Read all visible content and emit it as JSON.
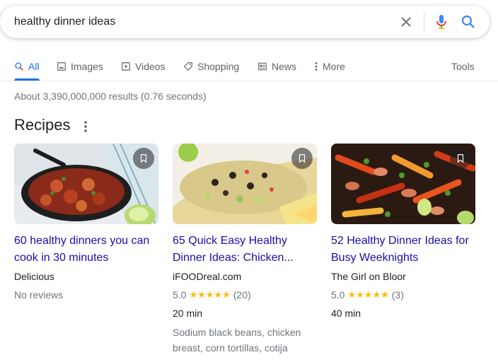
{
  "search": {
    "query": "healthy dinner ideas",
    "clear_icon": "close-icon",
    "mic_icon": "mic-icon",
    "search_icon": "search-icon"
  },
  "tabs": [
    {
      "label": "All",
      "icon": "search-icon",
      "active": true
    },
    {
      "label": "Images",
      "icon": "image-icon"
    },
    {
      "label": "Videos",
      "icon": "video-icon"
    },
    {
      "label": "Shopping",
      "icon": "tag-icon"
    },
    {
      "label": "News",
      "icon": "news-icon"
    },
    {
      "label": "More",
      "icon": "kebab-icon"
    },
    {
      "label": "Tools"
    }
  ],
  "results_stats": "About 3,390,000,000 results (0.76 seconds)",
  "recipes": {
    "title": "Recipes",
    "cards": [
      {
        "title_line1": "60 healthy dinners you can",
        "title_line2": "cook in 30 minutes",
        "source": "Delicious",
        "reviews": "No reviews"
      },
      {
        "title_line1": "65 Quick Easy Healthy",
        "title_line2": "Dinner Ideas: Chicken...",
        "source": "iFOODreal.com",
        "rating": "5.0",
        "stars": 5,
        "count": "(20)",
        "time": "20 min",
        "ingredients": "Sodium black beans, chicken breast, corn tortillas, cotija"
      },
      {
        "title_line1": "52 Healthy Dinner Ideas for",
        "title_line2": "Busy Weeknights",
        "source": "The Girl on Bloor",
        "rating": "5.0",
        "stars": 5,
        "count": "(3)",
        "time": "40 min"
      }
    ]
  },
  "colors": {
    "link": "#1a0dab",
    "accent": "#1a73e8",
    "star": "#fbbc04",
    "muted": "#70757a"
  }
}
